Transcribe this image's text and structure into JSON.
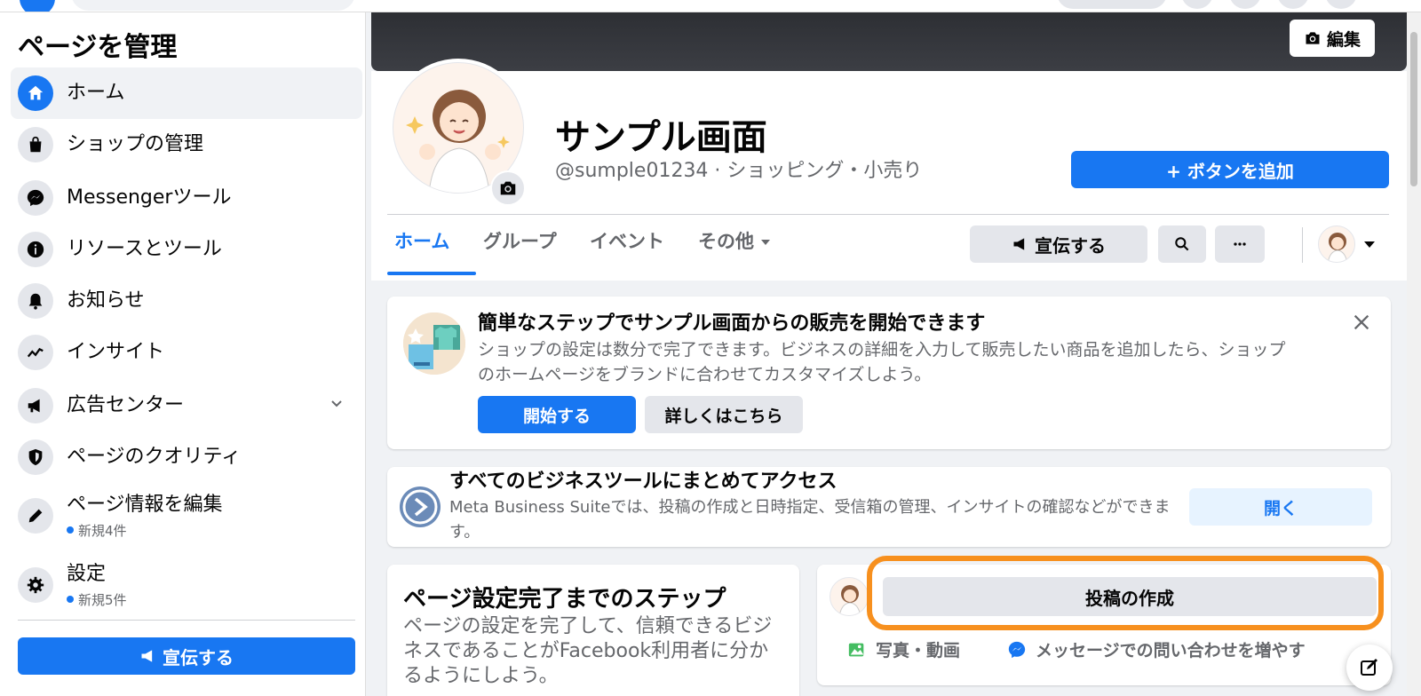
{
  "sidebar": {
    "title": "ページを管理",
    "items": [
      {
        "label": "ホーム",
        "icon": "home-icon"
      },
      {
        "label": "ショップの管理",
        "icon": "shopping-bag-icon"
      },
      {
        "label": "Messengerツール",
        "icon": "messenger-icon"
      },
      {
        "label": "リソースとツール",
        "icon": "info-icon"
      },
      {
        "label": "お知らせ",
        "icon": "bell-icon"
      },
      {
        "label": "インサイト",
        "icon": "insights-icon"
      },
      {
        "label": "広告センター",
        "icon": "megaphone-icon"
      },
      {
        "label": "ページのクオリティ",
        "icon": "shield-icon"
      },
      {
        "label": "ページ情報を編集",
        "icon": "pencil-icon",
        "badge": "新規4件"
      },
      {
        "label": "設定",
        "icon": "gear-icon",
        "badge": "新規5件"
      }
    ],
    "promote_label": "宣伝する"
  },
  "cover": {
    "edit_label": "編集"
  },
  "page": {
    "name": "サンプル画面",
    "subtitle": "@sumple01234 · ショッピング・小売り",
    "add_button": "+ ボタンを追加"
  },
  "tabs": [
    {
      "label": "ホーム"
    },
    {
      "label": "グループ"
    },
    {
      "label": "イベント"
    },
    {
      "label": "その他"
    }
  ],
  "header_actions": {
    "promote_label": "宣伝する"
  },
  "shop_card": {
    "title": "簡単なステップでサンプル画面からの販売を開始できます",
    "description": "ショップの設定は数分で完了できます。ビジネスの詳細を入力して販売したい商品を追加したら、ショップのホームページをブランドに合わせてカスタマイズしよう。",
    "start_label": "開始する",
    "more_label": "詳しくはこちら"
  },
  "business_card": {
    "title": "すべてのビジネスツールにまとめてアクセス",
    "description": "Meta Business Suiteでは、投稿の作成と日時指定、受信箱の管理、インサイトの確認などができます。",
    "open_label": "開く"
  },
  "steps_card": {
    "title": "ページ設定完了までのステップ",
    "description": "ページの設定を完了して、信頼できるビジネスであることがFacebook利用者に分かるようにしよう。"
  },
  "post_card": {
    "create_label": "投稿の作成",
    "photo_label": "写真・動画",
    "message_label": "メッセージでの問い合わせを増やす"
  },
  "colors": {
    "accent": "#1877f2",
    "highlight": "#f7901e",
    "background": "#f0f2f5"
  }
}
